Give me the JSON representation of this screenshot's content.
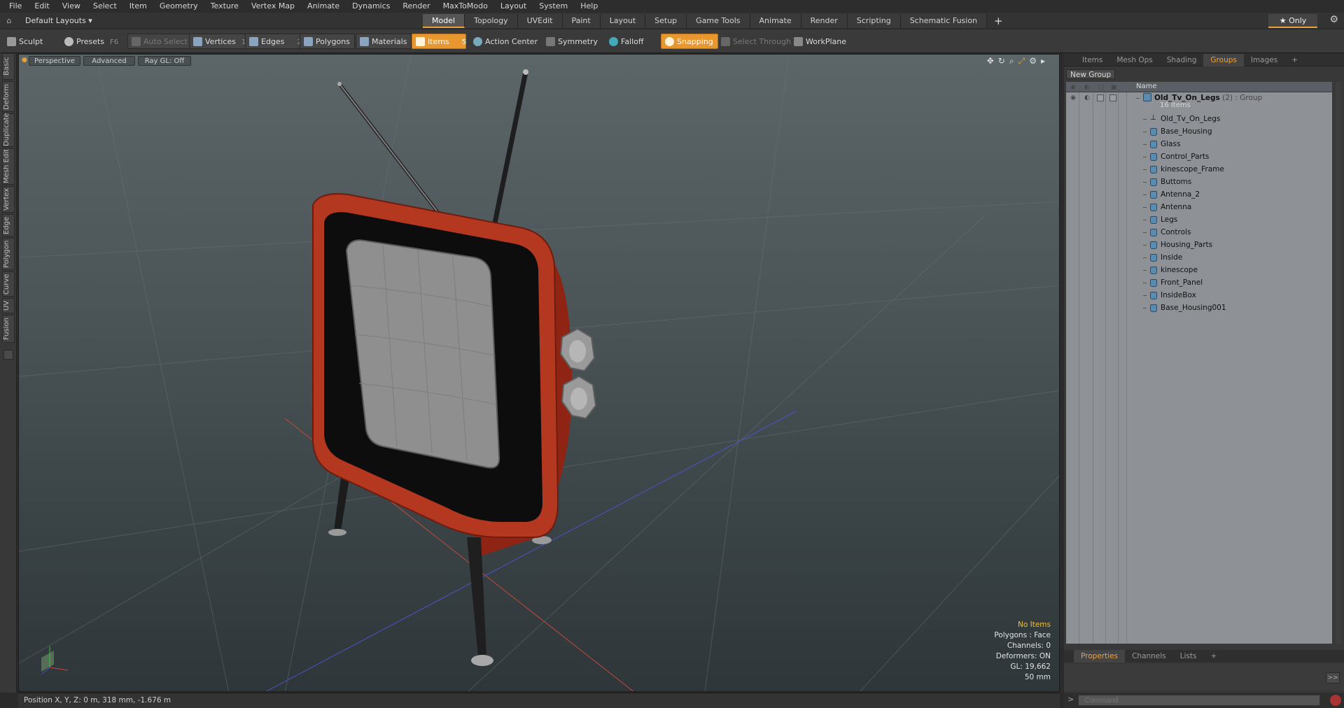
{
  "menu": [
    "File",
    "Edit",
    "View",
    "Select",
    "Item",
    "Geometry",
    "Texture",
    "Vertex Map",
    "Animate",
    "Dynamics",
    "Render",
    "MaxToModo",
    "Layout",
    "System",
    "Help"
  ],
  "layout_selector": "Default Layouts ▾",
  "mode_tabs": [
    "Model",
    "Topology",
    "UVEdit",
    "Paint",
    "Layout",
    "Setup",
    "Game Tools",
    "Animate",
    "Render",
    "Scripting",
    "Schematic Fusion"
  ],
  "active_mode_tab": "Model",
  "only_label": "★  Only",
  "toolbar": {
    "sculpt": "Sculpt",
    "presets": "Presets",
    "presets_key": "F6",
    "auto_select": "Auto Select",
    "vertices": "Vertices",
    "vertices_count": "1",
    "edges": "Edges",
    "edges_count": "2",
    "polygons": "Polygons",
    "materials": "Materials",
    "items": "Items",
    "items_count": "5",
    "action_center": "Action Center",
    "symmetry": "Symmetry",
    "falloff": "Falloff",
    "snapping": "Snapping",
    "select_through": "Select Through",
    "workplane": "WorkPlane"
  },
  "left_tabs": [
    "Basic",
    "Deform",
    "Duplicate",
    "Mesh Edit",
    "Vertex",
    "Edge",
    "Polygon",
    "Curve",
    "UV",
    "Fusion"
  ],
  "viewport": {
    "view": "Perspective",
    "shading": "Advanced",
    "raygl": "Ray GL: Off",
    "stats": {
      "no_items": "No Items",
      "polygons": "Polygons : Face",
      "channels": "Channels: 0",
      "deformers": "Deformers: ON",
      "gl": "GL: 19,662",
      "focal": "50 mm"
    }
  },
  "status_position": "Position X, Y, Z:   0 m, 318 mm, -1.676 m",
  "right_panel": {
    "tabs": [
      "Items",
      "Mesh Ops",
      "Shading",
      "Groups",
      "Images",
      "+"
    ],
    "active_tab": "Groups",
    "new_group": "New Group",
    "name_header": "Name",
    "group": {
      "name": "Old_Tv_On_Legs",
      "count": "(2)",
      "type": ": Group",
      "sub": "16 Items"
    },
    "items": [
      "Old_Tv_On_Legs",
      "Base_Housing",
      "Glass",
      "Control_Parts",
      "kinescope_Frame",
      "Buttoms",
      "Antenna_2",
      "Antenna",
      "Legs",
      "Controls",
      "Housing_Parts",
      "Inside",
      "kinescope",
      "Front_Panel",
      "InsideBox",
      "Base_Housing001"
    ],
    "bottom_tabs": [
      "Properties",
      "Channels",
      "Lists",
      "+"
    ],
    "active_bottom_tab": "Properties",
    "expand": ">>"
  },
  "command": {
    "prompt": ">",
    "placeholder": "Command"
  }
}
